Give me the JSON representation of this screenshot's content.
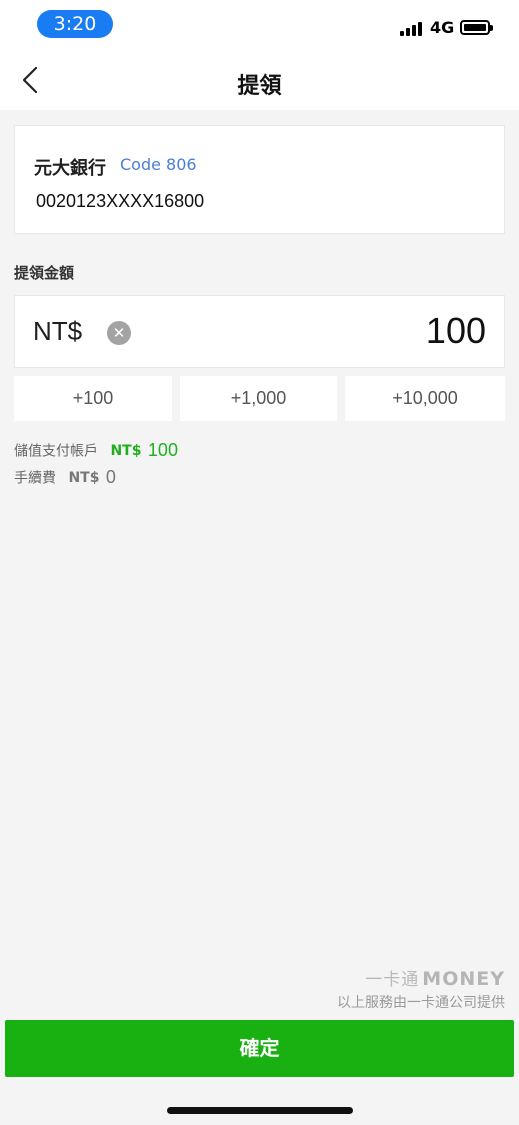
{
  "status_bar": {
    "time": "3:20",
    "network": "4G"
  },
  "nav": {
    "title": "提領",
    "back_icon": "chevron-left-icon"
  },
  "bank": {
    "name": "元大銀行",
    "code": "Code 806",
    "account_number": "0020123XXXX16800"
  },
  "amount_section": {
    "label": "提領金額",
    "currency": "NT$",
    "value": "100",
    "clear_icon": "clear-icon"
  },
  "quick_amounts": [
    "+100",
    "+1,000",
    "+10,000"
  ],
  "info": {
    "balance_label": "儲值支付帳戶",
    "balance_currency": "NT$",
    "balance_value": "100",
    "fee_label": "手續費",
    "fee_currency": "NT$",
    "fee_value": "0"
  },
  "provider": {
    "logo_text": "一卡通",
    "logo_brand": "MONEY",
    "text": "以上服務由一卡通公司提供"
  },
  "confirm_label": "確定",
  "colors": {
    "accent_green": "#19b112",
    "time_pill": "#1a7cf3",
    "code_blue": "#4a7ed6"
  }
}
